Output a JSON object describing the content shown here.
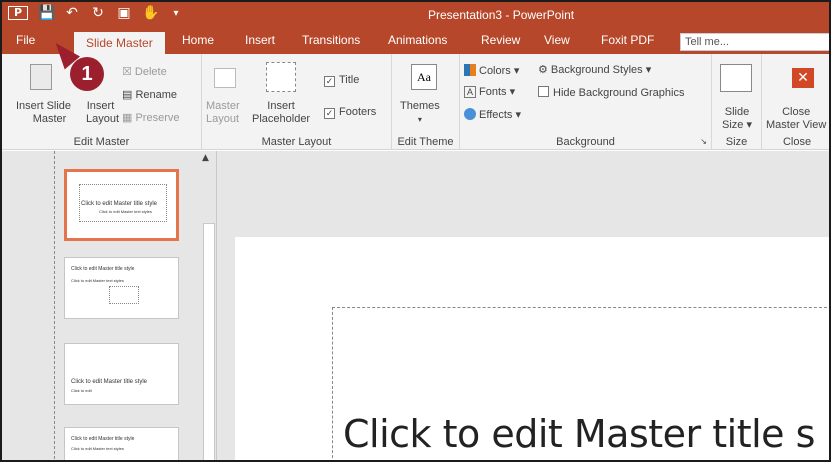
{
  "app": {
    "window_title": "Presentation3 - PowerPoint",
    "qat_icons": [
      "P",
      "save-icon",
      "undo-icon",
      "redo-icon",
      "present-icon",
      "touch-icon",
      "customize-icon"
    ]
  },
  "tabs": [
    "File",
    "Slide Master",
    "Home",
    "Insert",
    "Transitions",
    "Animations",
    "Review",
    "View",
    "Foxit PDF"
  ],
  "tellme": "Tell me...",
  "ribbon": {
    "edit_master": {
      "label": "Edit Master",
      "insert_slide_master": "Insert Slide Master",
      "insert_slide_l1": "Insert Slide",
      "insert_slide_l2": "Master",
      "insert_layout_l1": "Insert",
      "insert_layout_l2": "Layout",
      "delete": "Delete",
      "rename": "Rename",
      "preserve": "Preserve"
    },
    "master_layout": {
      "label": "Master Layout",
      "master_layout_l1": "Master",
      "master_layout_l2": "Layout",
      "insert_placeholder_l1": "Insert",
      "insert_placeholder_l2": "Placeholder",
      "title": "Title",
      "footers": "Footers"
    },
    "edit_theme": {
      "label": "Edit Theme",
      "themes": "Themes"
    },
    "background": {
      "label": "Background",
      "colors": "Colors",
      "fonts": "Fonts",
      "effects": "Effects",
      "background_styles": "Background Styles",
      "hide_background_graphics": "Hide Background Graphics"
    },
    "size": {
      "label": "Size",
      "slide_size_l1": "Slide",
      "slide_size_l2": "Size"
    },
    "close": {
      "label": "Close",
      "close_master_l1": "Close",
      "close_master_l2": "Master View"
    }
  },
  "callout": "1",
  "thumbnails": [
    {
      "title": "Click to edit Master title style",
      "subtitle": "Click to edit Master text styles"
    },
    {
      "title": "Click to edit Master title style",
      "subtitle": "Click to edit Master text styles"
    },
    {
      "title": "Click to edit Master title style",
      "subtitle": "Click to edit"
    },
    {
      "title": "Click to edit Master title style",
      "subtitle": "Click to edit Master text styles"
    }
  ],
  "slide": {
    "title_placeholder": "Click to edit Master title s"
  }
}
